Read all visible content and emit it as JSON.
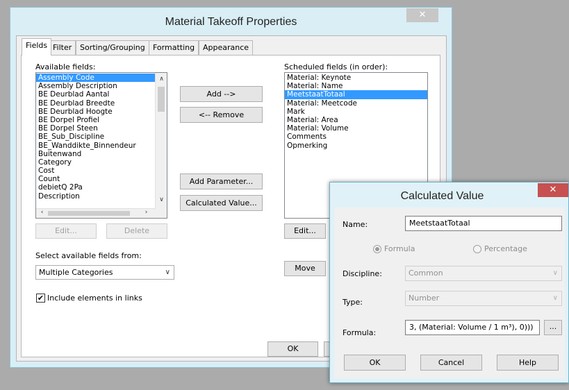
{
  "main_dialog": {
    "title": "Material Takeoff Properties",
    "close_glyph": "✕",
    "tabs": [
      "Fields",
      "Filter",
      "Sorting/Grouping",
      "Formatting",
      "Appearance"
    ],
    "available_label": "Available fields:",
    "available_fields": [
      "Assembly Code",
      "Assembly Description",
      "BE Deurblad Aantal",
      "BE Deurblad Breedte",
      "BE Deurblad Hoogte",
      "BE Dorpel Profiel",
      "BE Dorpel Steen",
      "BE_Sub_Discipline",
      "BE_Wanddikte_Binnendeur",
      "Buitenwand",
      "Category",
      "Cost",
      "Count",
      "debietQ 2Pa",
      "Description"
    ],
    "add_button": "Add -->",
    "remove_button": "<-- Remove",
    "add_parameter_button": "Add Parameter...",
    "calculated_value_button": "Calculated Value...",
    "scheduled_label": "Scheduled fields (in order):",
    "scheduled_fields": [
      "Material: Keynote",
      "Material: Name",
      "MeetstaatTotaal",
      "Material: Meetcode",
      "Mark",
      "Material: Area",
      "Material: Volume",
      "Comments",
      "Opmerking"
    ],
    "edit_button_left": "Edit...",
    "delete_button": "Delete",
    "edit_button_right": "Edit...",
    "move_button": "Move",
    "select_from_label": "Select available fields from:",
    "select_from_value": "Multiple Categories",
    "include_links_label": "Include elements in links",
    "include_links_checked": "✔",
    "ok_button": "OK"
  },
  "calc_dialog": {
    "title": "Calculated Value",
    "close_glyph": "✕",
    "name_label": "Name:",
    "name_value": "MeetstaatTotaal",
    "formula_radio_label": "Formula",
    "percentage_radio_label": "Percentage",
    "discipline_label": "Discipline:",
    "discipline_value": "Common",
    "type_label": "Type:",
    "type_value": "Number",
    "formula_label": "Formula:",
    "formula_value": "3, (Material: Volume / 1 m³), 0)))",
    "browse_button": "...",
    "ok_button": "OK",
    "cancel_button": "Cancel",
    "help_button": "Help"
  }
}
